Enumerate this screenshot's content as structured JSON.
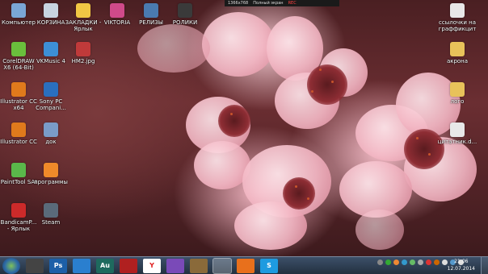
{
  "recorder": {
    "resolution": "1366x768",
    "mode": "Полный экран",
    "rec": "REC"
  },
  "desktop_icons": [
    {
      "label": "Компьютер",
      "icon": "computer-icon",
      "color": "#7aa6d6"
    },
    {
      "label": "КОРЗИНА",
      "icon": "recycle-bin-icon",
      "color": "#c8d4e0"
    },
    {
      "label": "ЗАКЛАДКИ - Ярлык",
      "icon": "star-icon",
      "color": "#f2c744"
    },
    {
      "label": "VIKTORIA",
      "icon": "app-icon",
      "color": "#d04a8a"
    },
    {
      "label": "РЕЛИЗЫ",
      "icon": "folder-icon",
      "color": "#4a7ab0"
    },
    {
      "label": "РОЛИКИ",
      "icon": "folder-icon",
      "color": "#3a3a3a"
    },
    {
      "label": "CorelDRAW X6 (64-Bit)",
      "icon": "coreldraw-icon",
      "color": "#6abf3c"
    },
    {
      "label": "VKMusic 4",
      "icon": "vkmusic-icon",
      "color": "#3d8fd6"
    },
    {
      "label": "HM2.jpg",
      "icon": "image-file-icon",
      "color": "#c03a3a"
    },
    {
      "label": "Illustrator CC x64",
      "icon": "illustrator-icon",
      "color": "#e07a1c"
    },
    {
      "label": "Sony PC Compani...",
      "icon": "sony-icon",
      "color": "#2a6fbf"
    },
    {
      "label": "Illustrator CC",
      "icon": "illustrator-icon",
      "color": "#e07a1c"
    },
    {
      "label": "док",
      "icon": "document-folder-icon",
      "color": "#7a9cc8"
    },
    {
      "label": "PaintTool SAI",
      "icon": "painttool-icon",
      "color": "#5ab84a"
    },
    {
      "label": "программы",
      "icon": "programs-icon",
      "color": "#f08a2a"
    },
    {
      "label": "BandicamP... - Ярлык",
      "icon": "bandicam-icon",
      "color": "#cc2a2a"
    },
    {
      "label": "Steam",
      "icon": "steam-icon",
      "color": "#5a6a7a"
    },
    {
      "label": "ссылочки на граффикцит",
      "icon": "text-file-icon",
      "color": "#e8e8e8"
    },
    {
      "label": "акрона",
      "icon": "folder-icon",
      "color": "#e8c25a"
    },
    {
      "label": "лого",
      "icon": "folder-icon",
      "color": "#e8c25a"
    },
    {
      "label": "цитатник.d...",
      "icon": "text-file-icon",
      "color": "#e8e8e8"
    }
  ],
  "taskbar": {
    "apps": [
      {
        "name": "window-manager-icon",
        "text": "",
        "color": "#444"
      },
      {
        "name": "photoshop-icon",
        "text": "Ps",
        "color": "#1c5fa8"
      },
      {
        "name": "teamviewer-icon",
        "text": "",
        "color": "#2a7fcf"
      },
      {
        "name": "audition-icon",
        "text": "Au",
        "color": "#1e6a5e"
      },
      {
        "name": "record-icon",
        "text": "",
        "color": "#b02020"
      },
      {
        "name": "yandex-icon",
        "text": "Y",
        "color": "#ffffff"
      },
      {
        "name": "visual-studio-icon",
        "text": "",
        "color": "#7a4ab8"
      },
      {
        "name": "archive-icon",
        "text": "",
        "color": "#8a6a3a"
      },
      {
        "name": "explorer-icon",
        "text": "",
        "color": "#e8c25a",
        "active": true
      },
      {
        "name": "firefox-icon",
        "text": "",
        "color": "#e8701c"
      },
      {
        "name": "skype-icon",
        "text": "S",
        "color": "#1e9be0"
      },
      {
        "name": "terminal-icon",
        "text": "",
        "color": "#333"
      }
    ],
    "clock_time": "21:06",
    "clock_date": "12.07.2014"
  }
}
